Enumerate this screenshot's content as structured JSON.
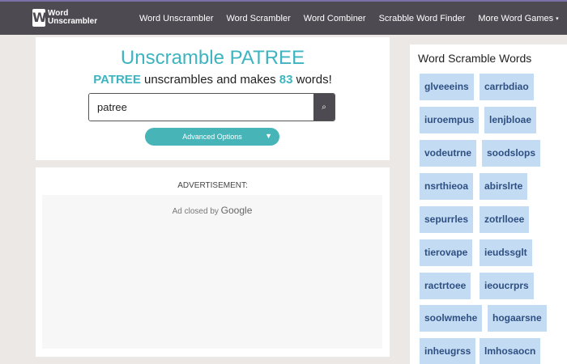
{
  "header": {
    "logo_line1": "Word",
    "logo_line2": "Unscrambler",
    "nav": [
      {
        "label": "Word Unscrambler"
      },
      {
        "label": "Word Scrambler"
      },
      {
        "label": "Word Combiner"
      },
      {
        "label": "Scrabble Word Finder"
      },
      {
        "label": "More Word Games"
      }
    ],
    "nav_caret": "▾"
  },
  "search": {
    "title": "Unscramble PATREE",
    "subtitle_word": "PATREE",
    "subtitle_mid": " unscrambles and makes ",
    "subtitle_count": "83",
    "subtitle_end": " words!",
    "input_value": "patree",
    "search_icon": "⌕",
    "advanced_label": "Advanced Options",
    "advanced_icon": "▼"
  },
  "ad": {
    "label": "ADVERTISEMENT:",
    "closed_text": "Ad closed by ",
    "closed_brand": "Google"
  },
  "sidebar": {
    "title": "Word Scramble Words",
    "words": [
      "glveeeins",
      "carrbdiao",
      "iuroempus",
      "lenjbloae",
      "vodeutrne",
      "soodslops",
      "nsrthieoa",
      "abirslrte",
      "sepurrles",
      "zotrlloee",
      "tierovape",
      "ieudssglt",
      "ractrtoee",
      "ieoucrprs",
      "soolwmehe",
      "hogaarsne",
      "inheugrss",
      "lmhosaocn"
    ]
  },
  "colors": {
    "topbar": "#4d4a52",
    "accent": "#3eb4c1",
    "tag_bg": "#c3dcf4",
    "tag_text": "#2f4f82"
  }
}
